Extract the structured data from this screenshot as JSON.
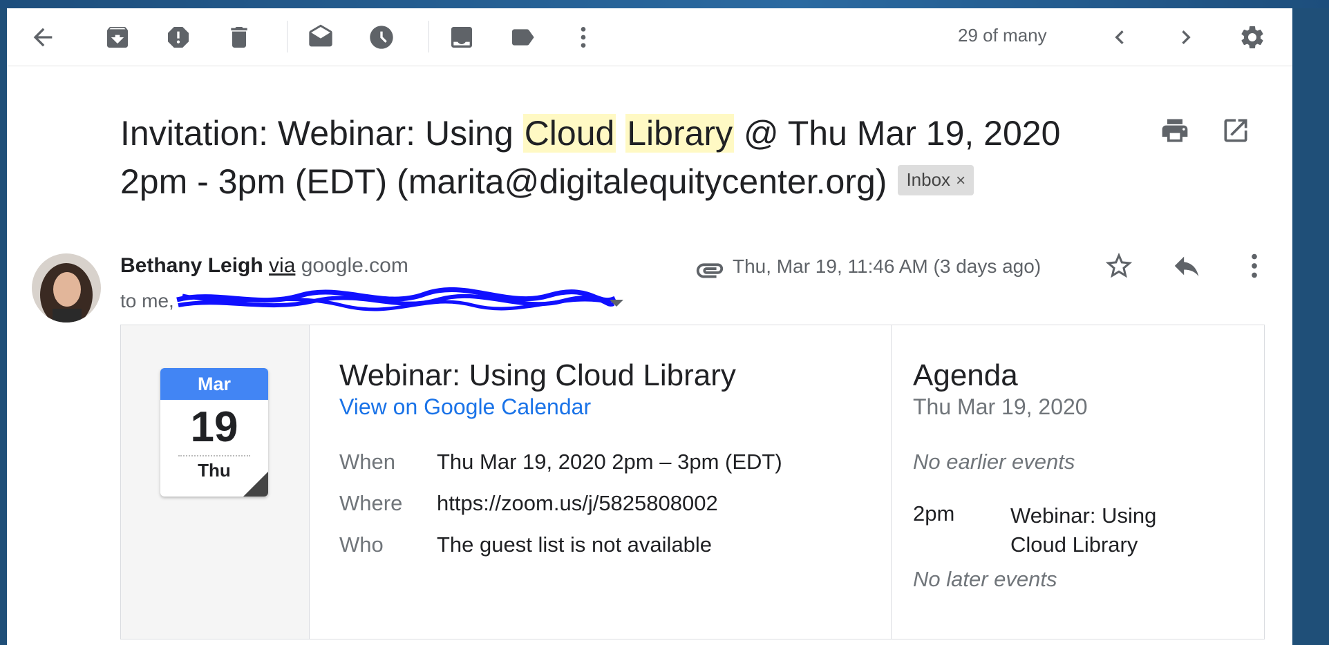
{
  "toolbar": {
    "icons": [
      "back-arrow-icon",
      "archive-icon",
      "report-spam-icon",
      "delete-icon",
      "mark-unread-icon",
      "snooze-icon",
      "move-to-icon",
      "label-icon",
      "more-vert-icon",
      "chevron-left-icon",
      "chevron-right-icon",
      "settings-gear-icon"
    ],
    "pager_text": "29 of many"
  },
  "subject": {
    "part1": "Invitation: Webinar: Using ",
    "highlight1": "Cloud",
    "space": " ",
    "highlight2": "Library",
    "part2": " @ Thu Mar 19, 2020 2pm - 3pm (EDT) (marita@digitalequitycenter.org)",
    "label_chip": "Inbox",
    "chip_close": "×"
  },
  "message": {
    "sender_name": "Bethany Leigh",
    "via_word": "via",
    "via_domain": "google.com",
    "to_prefix": "to me,",
    "date": "Thu, Mar 19, 11:46 AM (3 days ago)"
  },
  "invite": {
    "cal_month": "Mar",
    "cal_day": "19",
    "cal_dow": "Thu",
    "title": "Webinar: Using Cloud Library",
    "view_link": "View on Google Calendar",
    "rows": [
      {
        "label": "When",
        "value": "Thu Mar 19, 2020 2pm – 3pm (EDT)"
      },
      {
        "label": "Where",
        "value": "https://zoom.us/j/5825808002"
      },
      {
        "label": "Who",
        "value": "The guest list is not available"
      }
    ]
  },
  "agenda": {
    "title": "Agenda",
    "date": "Thu Mar 19, 2020",
    "no_earlier": "No earlier events",
    "event_time": "2pm",
    "event_name": "Webinar: Using Cloud Library",
    "no_later": "No later events"
  },
  "colors": {
    "link": "#1a73e8",
    "calendar_blue": "#4285f4",
    "highlight": "#fff9c4",
    "redaction_scribble": "#1010ff"
  }
}
